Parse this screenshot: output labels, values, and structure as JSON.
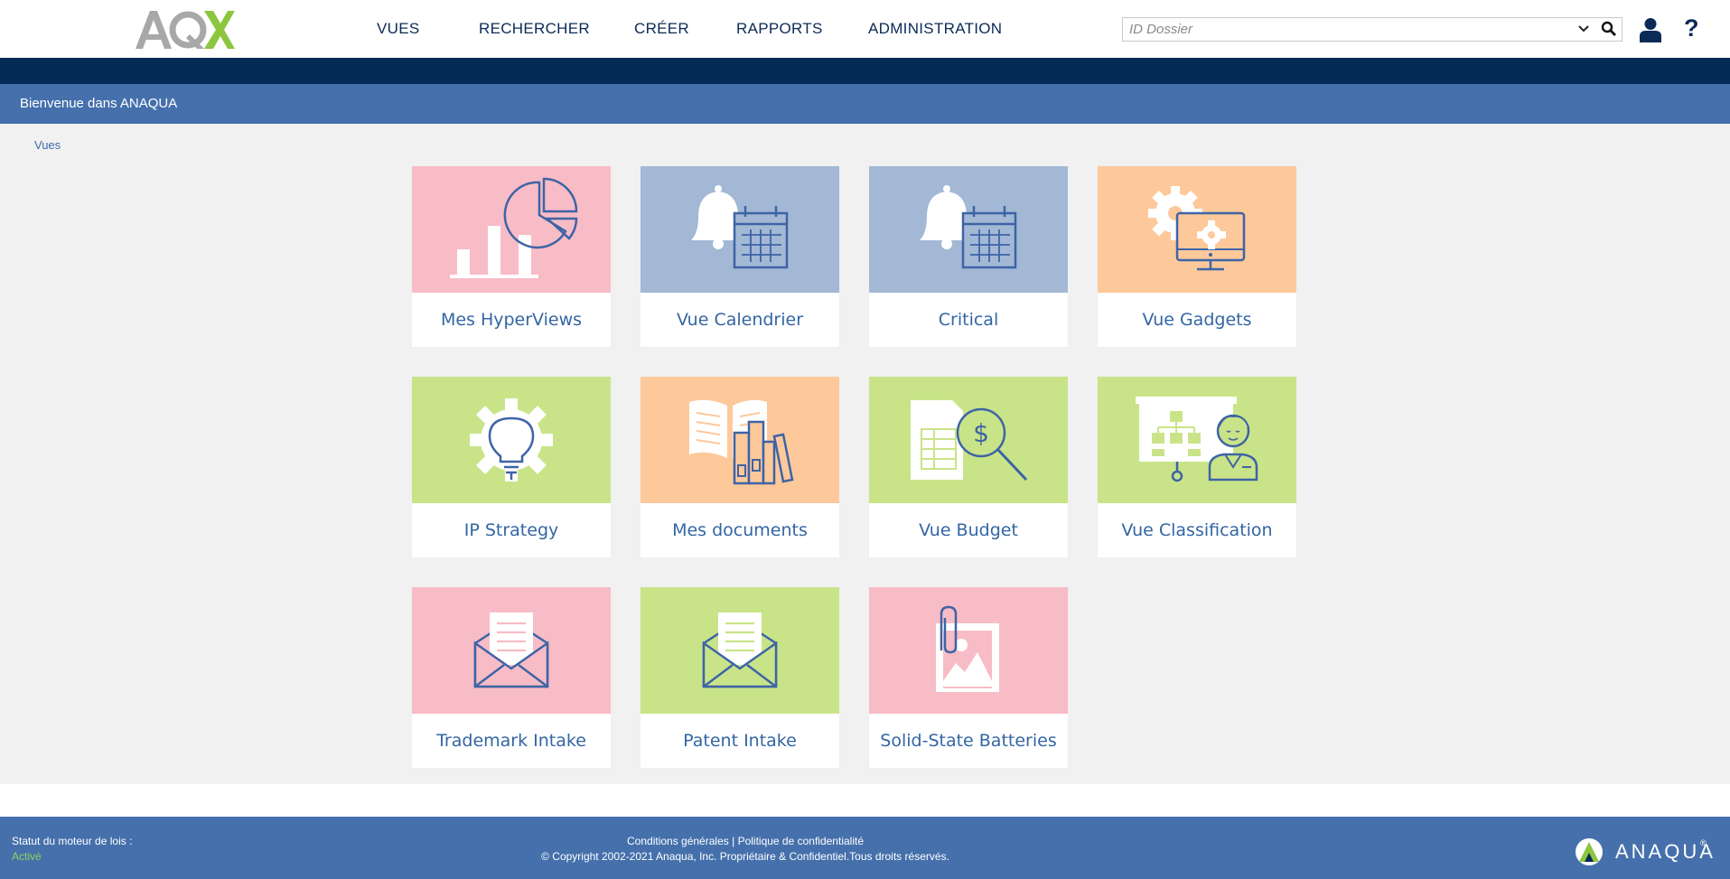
{
  "header": {
    "logo": {
      "text": "AQX",
      "colors": {
        "aq": "#a8a8a8",
        "x": "#8cc63f"
      }
    },
    "nav": [
      "VUES",
      "RECHERCHER",
      "CRÉER",
      "RAPPORTS",
      "ADMINISTRATION"
    ],
    "search": {
      "placeholder": "ID Dossier",
      "value": ""
    },
    "icons": [
      "chevron-down-icon",
      "search-icon",
      "user-icon",
      "help-icon"
    ],
    "help_label": "?"
  },
  "welcome": {
    "title": "Bienvenue dans ANAQUA"
  },
  "breadcrumb": {
    "label": "Vues"
  },
  "tiles": [
    {
      "label": "Mes HyperViews",
      "color": "#f8bcc6",
      "icon": "bar-pie-chart-icon"
    },
    {
      "label": "Vue Calendrier",
      "color": "#a2b8d4",
      "icon": "bell-calendar-icon"
    },
    {
      "label": "Critical",
      "color": "#a2b8d4",
      "icon": "bell-calendar-icon"
    },
    {
      "label": "Vue Gadgets",
      "color": "#fdc99b",
      "icon": "gears-monitor-icon"
    },
    {
      "label": "IP Strategy",
      "color": "#c9e488",
      "icon": "gear-lightbulb-icon"
    },
    {
      "label": "Mes documents",
      "color": "#fdc99b",
      "icon": "book-binders-icon"
    },
    {
      "label": "Vue Budget",
      "color": "#c9e488",
      "icon": "spreadsheet-magnifier-icon"
    },
    {
      "label": "Vue Classification",
      "color": "#c9e488",
      "icon": "presenter-org-chart-icon"
    },
    {
      "label": "Trademark Intake",
      "color": "#f8bcc6",
      "icon": "envelope-letter-icon"
    },
    {
      "label": "Patent Intake",
      "color": "#c9e488",
      "icon": "envelope-letter-icon"
    },
    {
      "label": "Solid-State Batteries",
      "color": "#f8bcc6",
      "icon": "paperclip-image-icon"
    }
  ],
  "colors": {
    "icon_stroke": "#3e64a6",
    "dark_navy": "#052a55",
    "blue_bar": "#4570ac",
    "active_green": "#8fd35b"
  },
  "footer": {
    "status_label": "Statut du moteur de lois :",
    "status_value": "Activé",
    "terms": "Conditions générales",
    "separator": "|",
    "privacy": "Politique de confidentialité",
    "copyright": "© Copyright 2002-2021 Anaqua, Inc. Propriétaire & Confidentiel.Tous droits réservés.",
    "brand": "ANAQUA",
    "registered": "®"
  }
}
